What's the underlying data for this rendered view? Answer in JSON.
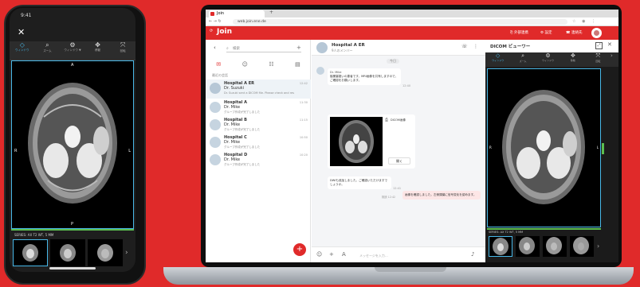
{
  "phone": {
    "time": "9:41",
    "close_glyph": "✕",
    "toolbar": [
      "ウィンドウ",
      "ズーム",
      "ウィンドウ ▼",
      "移動",
      "回転"
    ],
    "scan_label_left": "R",
    "scan_label_right": "L",
    "scan_label_top": "A",
    "scan_label_bottom": "P",
    "series_title": "SERIES: AX T2 WT, 5 MM",
    "thumb_labels": [
      "AX T2 5mm",
      "AX T2",
      "AX FLAIR"
    ]
  },
  "browser": {
    "tab_title": "Join",
    "url": "web.join.ene.de"
  },
  "app": {
    "brand": "Join",
    "header_actions": [
      "外部連携",
      "設定",
      "連絡先"
    ],
    "search_placeholder": "検索",
    "section_label": "最近の会話",
    "conversations": [
      {
        "title": "Hospital A ER",
        "sub": "Dr. Suzuki",
        "msg": "Dr. Suzuki sent a DICOM file. Please check and respond.",
        "time": "12:42"
      },
      {
        "title": "Hospital A",
        "sub": "Dr. Mike",
        "msg": "グループ作成が完了しました",
        "time": "11:30"
      },
      {
        "title": "Hospital B",
        "sub": "Dr. Mike",
        "msg": "グループ作成が完了しました",
        "time": "11:15"
      },
      {
        "title": "Hospital C",
        "sub": "Dr. Mike",
        "msg": "グループ作成が完了しました",
        "time": "10:50"
      },
      {
        "title": "Hospital D",
        "sub": "Dr. Mike",
        "msg": "グループ作成が完了しました",
        "time": "10:20"
      }
    ],
    "chat": {
      "title": "Hospital A ER",
      "subtitle": "9人のメンバー",
      "date_label": "今日",
      "sender": "Dr. Mike",
      "msg1": "脳梗塞疑いの患者です。MRI画像を共有しますので、ご確認をお願いします。",
      "msg1_time": "12:40",
      "file_label": "DICOM画像",
      "open_label": "開く",
      "msg2": "DWIも追加しました。ご確認いただけますでしょうか。",
      "msg2_time": "12:41",
      "reply": "画像を確認しました。左側頭葉に信号変化を認めます。",
      "reply_meta": "既読 12:42",
      "input_placeholder": "メッセージを入力..."
    },
    "viewer": {
      "title": "DICOM ビューワー",
      "tools": [
        "ウィンドウ",
        "ズーム",
        "ウィンドウ",
        "移動",
        "回転"
      ],
      "side_label_right": "L",
      "side_label_left": "R",
      "series_title": "SERIES: AX T2 WT, 5 MM",
      "thumb_count": 4
    }
  }
}
